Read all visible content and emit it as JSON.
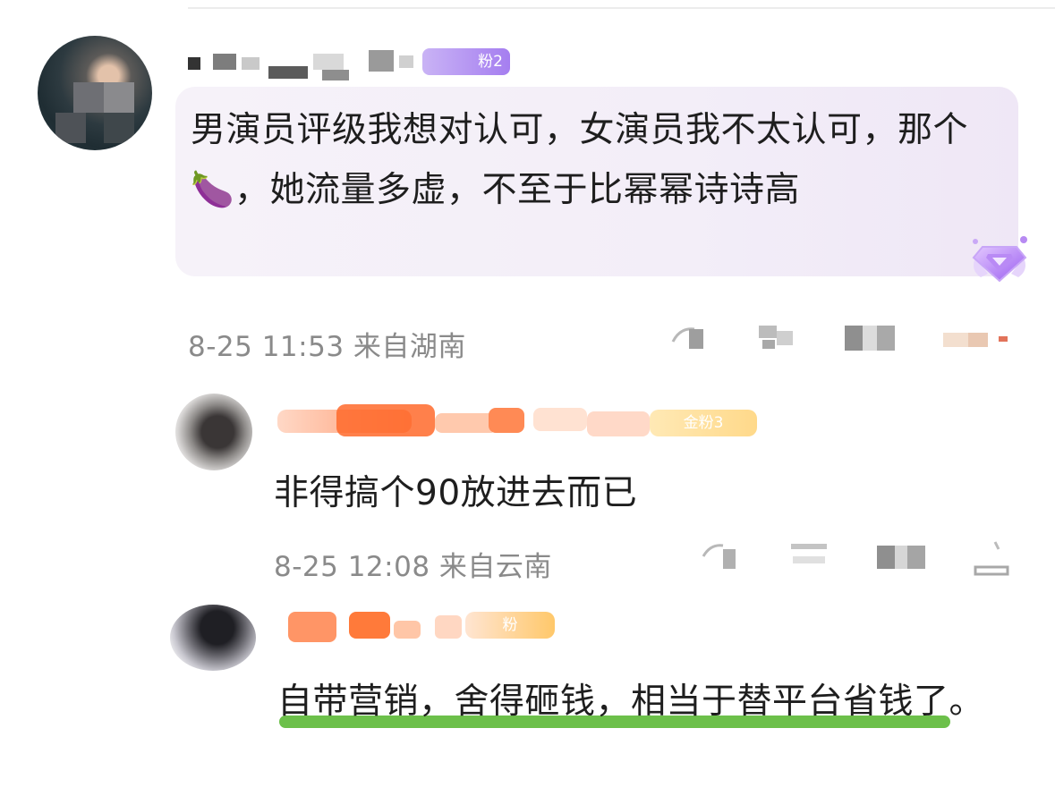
{
  "colors": {
    "comment_bubble": "#f3eef8",
    "fan_badge": "#a57ef0",
    "meta_text": "#8a8a8a",
    "highlight_underline": "#6cc04a"
  },
  "main_comment": {
    "fan_badge": "粉2",
    "text": "男演员评级我想对认可，女演员我不太认可，那个🍆，她流量多虚，不至于比幂幂诗诗高",
    "time": "8-25 11:53",
    "location": "来自湖南"
  },
  "reply_1": {
    "fan_badge": "金粉3",
    "text": "非得搞个90放进去而已",
    "time": "8-25 12:08",
    "location": "来自云南"
  },
  "reply_2": {
    "fan_badge": "粉",
    "text": "自带营销，舍得砸钱，相当于替平台省钱了。"
  },
  "icons": [
    "vip-diamond-icon",
    "share-icon",
    "comment-icon",
    "like-icon",
    "more-icon"
  ]
}
